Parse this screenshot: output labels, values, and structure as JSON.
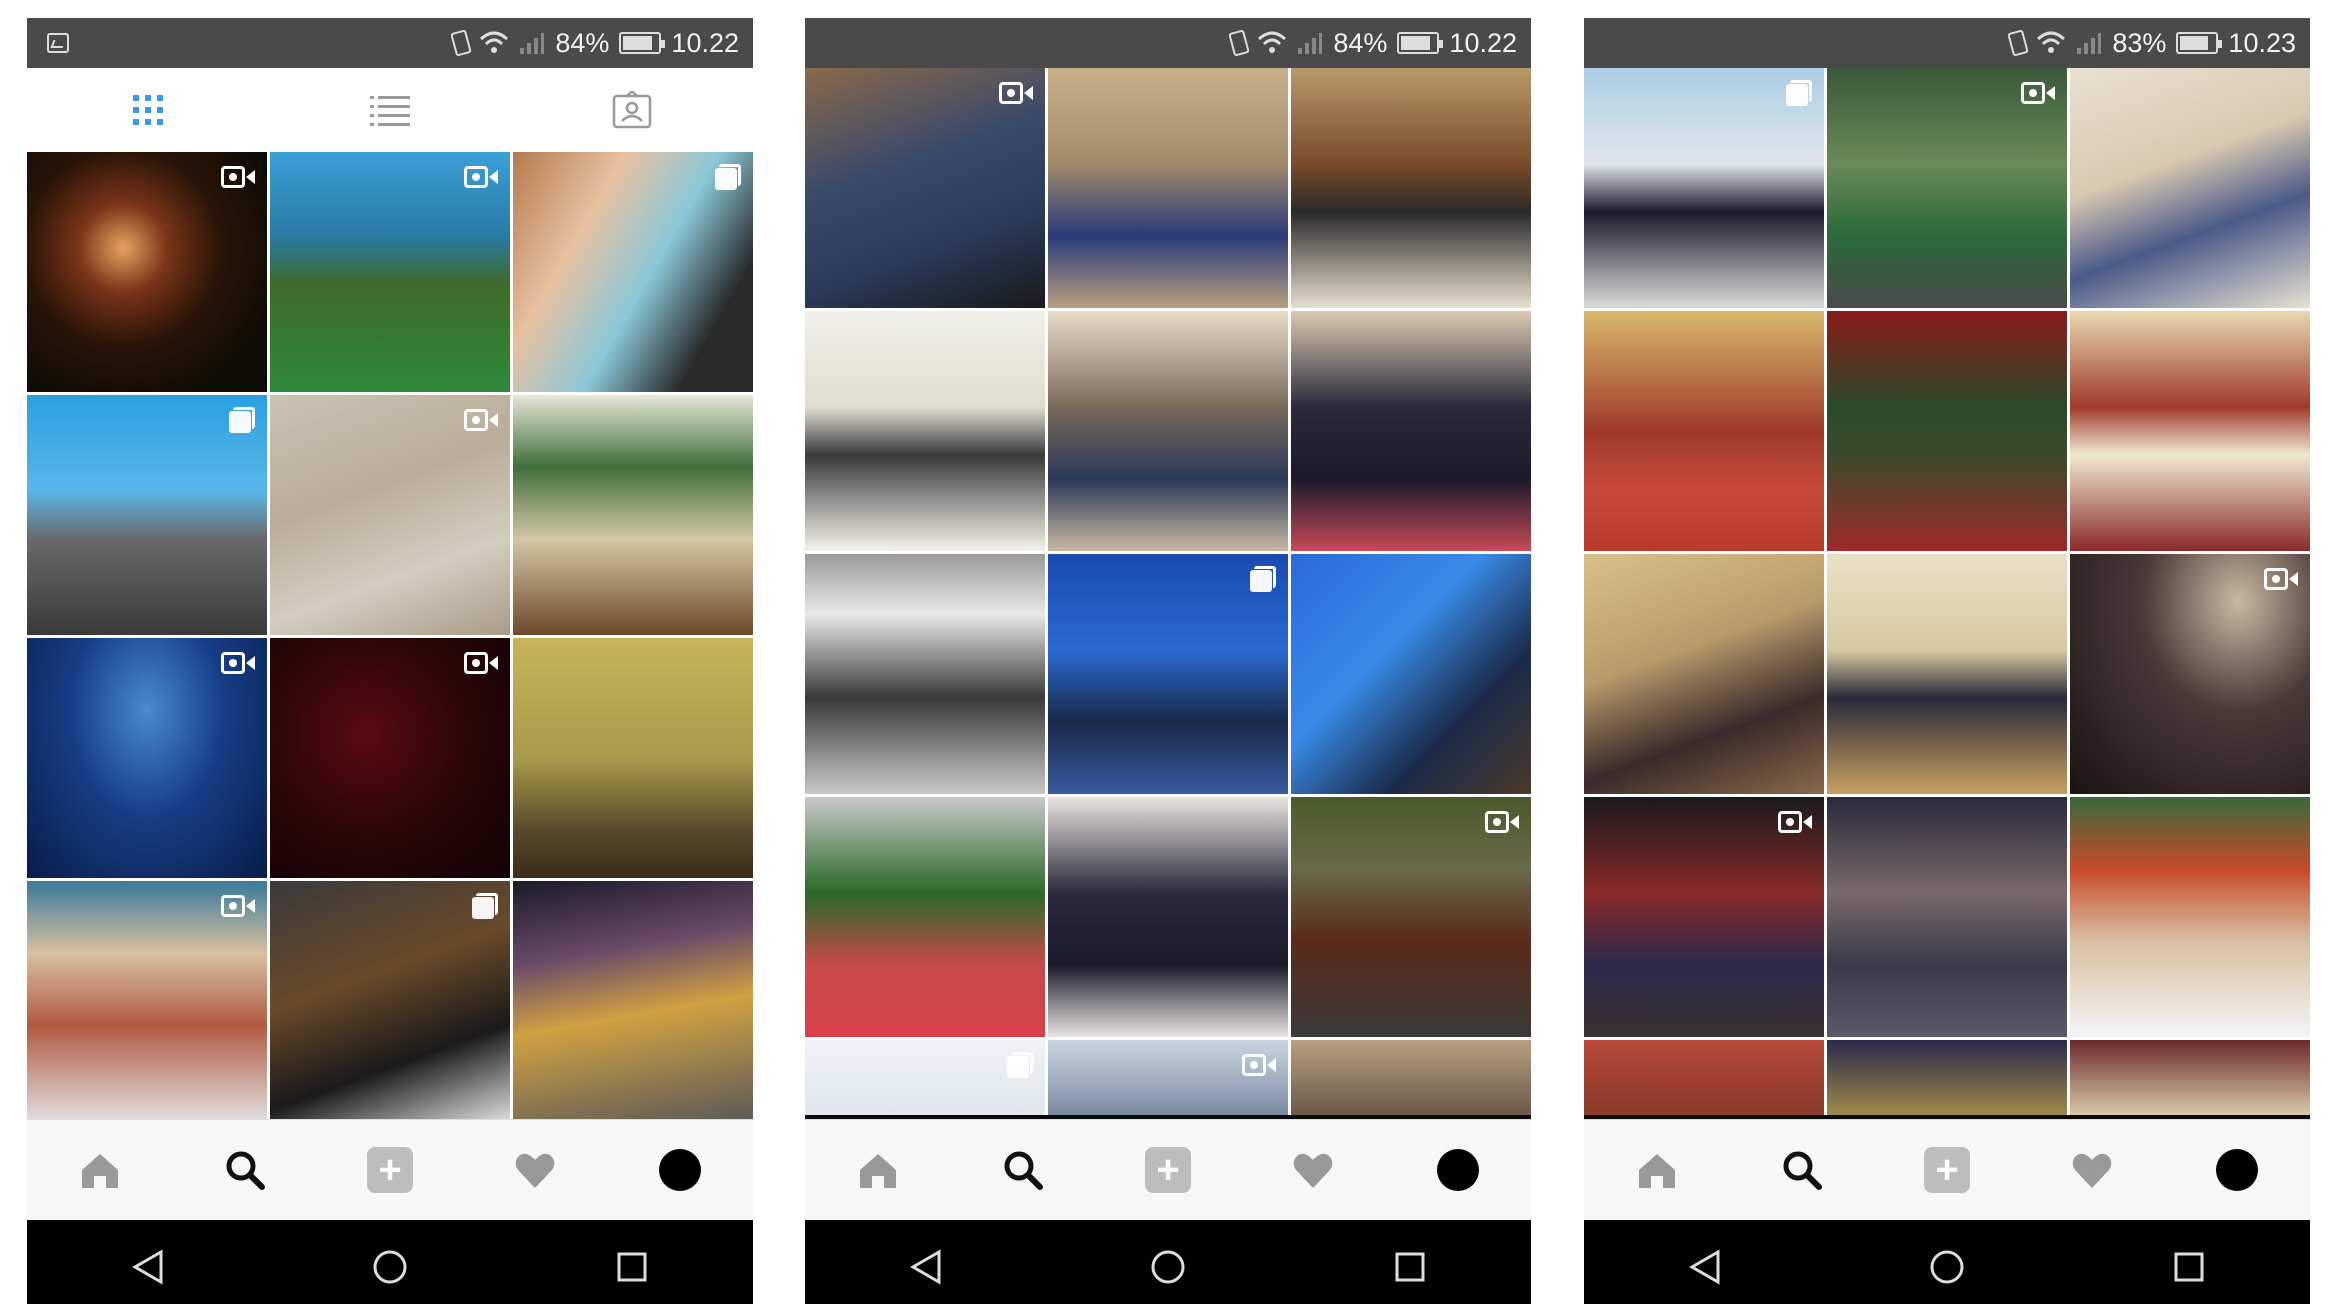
{
  "screens": [
    {
      "status": {
        "battery": "84%",
        "time": "10.22",
        "battery_level": 0.84
      },
      "has_profile_tabs": true,
      "tiles": [
        {
          "bg": "radial-gradient(ellipse at 40% 40%,#e8a060 0%,#7a3418 22%,#2a1408 48%,#0e0c06 80%)",
          "overlay": "video"
        },
        {
          "bg": "linear-gradient(180deg,#3aa0d8 0%,#2a7aa6 35%,#3f6a2a 55%,#2e8a3a 100%)",
          "overlay": "video"
        },
        {
          "bg": "linear-gradient(120deg,#b47a4c 0%,#e7c0a0 30%,#8ac7d8 55%,#2a2a2a 80%)",
          "overlay": "multi"
        },
        {
          "bg": "linear-gradient(180deg,#2aa0e0 0%,#58b6e8 40%,#6a6a6a 60%,#3a3a3a 100%)",
          "overlay": "multi"
        },
        {
          "bg": "linear-gradient(160deg,#c9c2b4 0%,#b8ad98 40%,#d3ccbf 70%,#a89c88 100%)",
          "overlay": "video"
        },
        {
          "bg": "linear-gradient(180deg,#e6e8d8 0%,#3f6e3a 30%,#d4c6a4 60%,#6e4a2a 100%)",
          "overlay": ""
        },
        {
          "bg": "radial-gradient(ellipse at 50% 30%,#4a8ad0 0%,#163e86 45%,#0a1c48 100%)",
          "overlay": "video"
        },
        {
          "bg": "radial-gradient(ellipse at 40% 40%,#5a0a10 0%,#2a0608 50%,#120204 100%)",
          "overlay": "video"
        },
        {
          "bg": "linear-gradient(180deg,#c7b45c 0%,#a89a4a 50%,#5a4a2a 80%,#3a2a1a 100%)",
          "overlay": ""
        },
        {
          "bg": "linear-gradient(180deg,#3a7a9a 0%,#d8c0a0 30%,#b05a40 60%,#e0e0e0 100%)",
          "overlay": "video"
        },
        {
          "bg": "linear-gradient(160deg,#3a3a3a 0%,#6a4a2a 40%,#1a1a1a 70%,#e0e0e0 100%)",
          "overlay": "multi"
        },
        {
          "bg": "linear-gradient(170deg,#1a1a2a 0%,#6a4a6a 30%,#d0a040 55%,#5a5a5a 100%)",
          "overlay": ""
        }
      ]
    },
    {
      "status": {
        "battery": "84%",
        "time": "10.22",
        "battery_level": 0.84
      },
      "has_profile_tabs": false,
      "tiles": [
        {
          "bg": "linear-gradient(160deg,#8a6a4a 0%,#3a4a6a 40%,#2a3a5a 70%,#1a1a1a 100%)",
          "overlay": "video"
        },
        {
          "bg": "linear-gradient(180deg,#c8b08a 0%,#a08a6a 40%,#2a3a7a 70%,#b8a080 100%)",
          "overlay": ""
        },
        {
          "bg": "linear-gradient(180deg,#b89a6a 0%,#7a4a2a 40%,#2a2a2a 60%,#e8e0d0 100%)",
          "overlay": ""
        },
        {
          "bg": "linear-gradient(180deg,#f0f0ea 0%,#e0dcd0 40%,#3a3a3a 60%,#f4f2ea 100%)",
          "overlay": ""
        },
        {
          "bg": "linear-gradient(180deg,#e8dcc8 0%,#7a6a5a 40%,#2a3a5a 70%,#c8b8a0 100%)",
          "overlay": ""
        },
        {
          "bg": "linear-gradient(180deg,#dccab4 0%,#2a2a3a 40%,#1a1a2a 70%,#c84a5a 100%)",
          "overlay": ""
        },
        {
          "bg": "linear-gradient(180deg,#9a9a9a 0%,#e8e8e8 25%,#3a3a3a 60%,#c8c8c8 100%)",
          "overlay": ""
        },
        {
          "bg": "linear-gradient(180deg,#1a4ab0 0%,#2a6ad0 40%,#1a2a4a 70%,#3a5aa0 100%)",
          "overlay": "multi"
        },
        {
          "bg": "linear-gradient(135deg,#2a6ad8 0%,#3a8ae8 40%,#1a2a4a 70%,#4a3a2a 100%)",
          "overlay": ""
        },
        {
          "bg": "linear-gradient(180deg,#c8c8c8 0%,#2a6a2a 40%,#c84a4a 70%,#d8404a 100%)",
          "overlay": ""
        },
        {
          "bg": "linear-gradient(180deg,#e8e4e0 0%,#2a2a3a 40%,#1a1a2a 70%,#e8e4e0 100%)",
          "overlay": ""
        },
        {
          "bg": "linear-gradient(180deg,#4a5a2a 0%,#6a6a4a 30%,#5a2a1a 60%,#3a3a3a 100%)",
          "overlay": "video"
        },
        {
          "bg": "linear-gradient(180deg,#eef2f6 0%,#e0e6ec 100%)",
          "overlay": "multi"
        },
        {
          "bg": "linear-gradient(180deg,#cad6e2 0%,#7a8aa0 100%)",
          "overlay": "video"
        },
        {
          "bg": "linear-gradient(180deg,#b8a080 0%,#6a5a4a 100%)",
          "overlay": ""
        }
      ]
    },
    {
      "status": {
        "battery": "83%",
        "time": "10.23",
        "battery_level": 0.83
      },
      "has_profile_tabs": false,
      "tiles": [
        {
          "bg": "linear-gradient(180deg,#aacde4 0%,#e0e6ea 40%,#1a1a2a 60%,#dcdcdc 100%)",
          "overlay": "multi"
        },
        {
          "bg": "linear-gradient(180deg,#3a5a3a 0%,#6a8a5a 40%,#2a6a3a 70%,#4a4a4a 100%)",
          "overlay": "video"
        },
        {
          "bg": "linear-gradient(160deg,#e8e0d0 0%,#d8c8b0 40%,#4a5a8a 65%,#e8e0d0 100%)",
          "overlay": ""
        },
        {
          "bg": "linear-gradient(180deg,#d8b86a 0%,#a03a2a 50%,#c84a3a 75%,#b83a2a 100%)",
          "overlay": ""
        },
        {
          "bg": "linear-gradient(180deg,#8a1a1a 0%,#2a4a2a 40%,#3a4a2a 60%,#a02a2a 100%)",
          "overlay": ""
        },
        {
          "bg": "linear-gradient(180deg,#e8d8b0 0%,#a03a2a 40%,#f0e8d0 60%,#8a2a2a 100%)",
          "overlay": ""
        },
        {
          "bg": "linear-gradient(160deg,#d8c08a 0%,#b89a6a 40%,#3a2a2a 70%,#8a6a4a 100%)",
          "overlay": ""
        },
        {
          "bg": "linear-gradient(180deg,#e8e0c8 0%,#d8c8a0 40%,#2a2a3a 60%,#c8a060 100%)",
          "overlay": ""
        },
        {
          "bg": "radial-gradient(ellipse at 70% 20%,#c8b8a0 0%,#4a3a3a 40%,#1a1212 100%)",
          "overlay": "video"
        },
        {
          "bg": "linear-gradient(180deg,#1a1a1a 0%,#8a2a2a 40%,#2a2a4a 70%,#3a3030 100%)",
          "overlay": "video"
        },
        {
          "bg": "linear-gradient(180deg,#2a2a3a 0%,#7a6a6a 40%,#3a3a4a 70%,#5a5a6a 100%)",
          "overlay": ""
        },
        {
          "bg": "linear-gradient(180deg,#3a6a3a 0%,#c84a2a 30%,#d8c0a0 60%,#f4f4f4 100%)",
          "overlay": ""
        },
        {
          "bg": "linear-gradient(180deg,#b84a3a 0%,#8a3a2a 100%)",
          "overlay": ""
        },
        {
          "bg": "linear-gradient(180deg,#2a2a4a 0%,#a08a4a 100%)",
          "overlay": ""
        },
        {
          "bg": "linear-gradient(180deg,#6a2a2a 0%,#d8c8a8 100%)",
          "overlay": ""
        }
      ]
    }
  ]
}
